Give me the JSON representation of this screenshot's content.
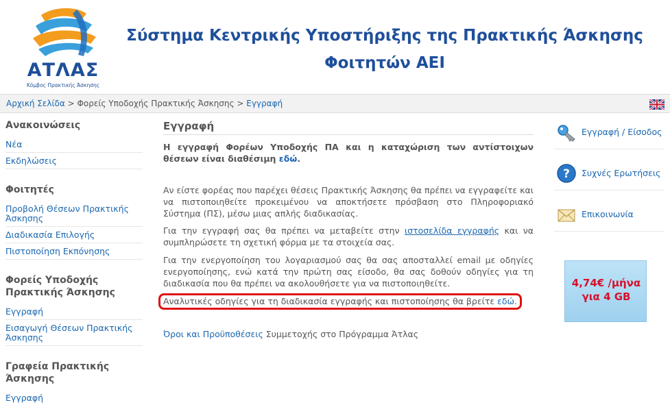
{
  "header": {
    "logo_text": "ΑΤΛΑΣ",
    "logo_sub": "Κόμβος Πρακτικής Άσκησης",
    "title_line1": "Σύστημα Κεντρικής Υποστήριξης της Πρακτικής Άσκησης",
    "title_line2": "Φοιτητών ΑΕΙ"
  },
  "breadcrumb": {
    "home": "Αρχική Σελίδα",
    "sep": " > ",
    "middle": "Φορείς Υποδοχής Πρακτικής Άσκησης",
    "current": "Εγγραφή"
  },
  "leftnav": {
    "announcements": {
      "heading": "Ανακοινώσεις",
      "items": [
        "Νέα",
        "Εκδηλώσεις"
      ]
    },
    "students": {
      "heading": "Φοιτητές",
      "items": [
        "Προβολή Θέσεων Πρακτικής Άσκησης",
        "Διαδικασία Επιλογής",
        "Πιστοποίηση Εκπόνησης"
      ]
    },
    "hosts": {
      "heading": "Φορείς Υποδοχής Πρακτικής Άσκησης",
      "items": [
        "Εγγραφή",
        "Εισαγωγή Θέσεων Πρακτικής Άσκησης"
      ]
    },
    "offices": {
      "heading": "Γραφεία Πρακτικής Άσκησης",
      "items": [
        "Εγγραφή"
      ]
    }
  },
  "main": {
    "heading": "Εγγραφή",
    "intro_bold": "Η εγγραφή Φορέων Υποδοχής ΠΑ και η καταχώριση των αντίστοιχων θέσεων είναι διαθέσιμη ",
    "intro_link": "εδώ",
    "intro_end": ".",
    "p1": "Αν είστε φορέας που παρέχει θέσεις Πρακτικής Άσκησης θα πρέπει να εγγραφείτε και να πιστοποιηθείτε προκειμένου να αποκτήσετε πρόσβαση στο Πληροφοριακό Σύστημα (ΠΣ), μέσω μιας απλής διαδικασίας.",
    "p2_before": "Για την εγγραφή σας θα πρέπει να μεταβείτε στην ",
    "p2_link": "ιστοσελίδα εγγραφής",
    "p2_after": " και να συμπληρώσετε τη σχετική φόρμα με τα στοιχεία σας.",
    "p3": "Για την ενεργοποίηση του λογαριασμού σας θα σας αποσταλλεί email με οδηγίες ενεργοποίησης, ενώ κατά την πρώτη σας είσοδο, θα σας δοθούν οδηγίες για τη διαδικασία που θα πρέπει να ακολουθήσετε για να πιστοποιηθείτε.",
    "p4_before": "Αναλυτικές οδηγίες για τη διαδικασία εγγραφής και πιστοποίησης θα βρείτε ",
    "p4_link": "εδώ",
    "p4_end": ".",
    "terms_link": "Όροι και Προϋποθέσεις",
    "terms_after": " Συμμετοχής στο Πρόγραμμα Άτλας"
  },
  "rightnav": {
    "items": [
      {
        "label": "Εγγραφή / Είσοδος",
        "icon": "key-icon"
      },
      {
        "label": "Συχνές Ερωτήσεις",
        "icon": "help-icon"
      },
      {
        "label": "Επικοινωνία",
        "icon": "mail-icon"
      }
    ]
  },
  "ad": {
    "line1": "4,74€ /μήνα",
    "line2": "για 4 GB"
  },
  "colors": {
    "brand_blue": "#1f4f9a",
    "link": "#1a67b0",
    "highlight_red": "#e01010"
  }
}
